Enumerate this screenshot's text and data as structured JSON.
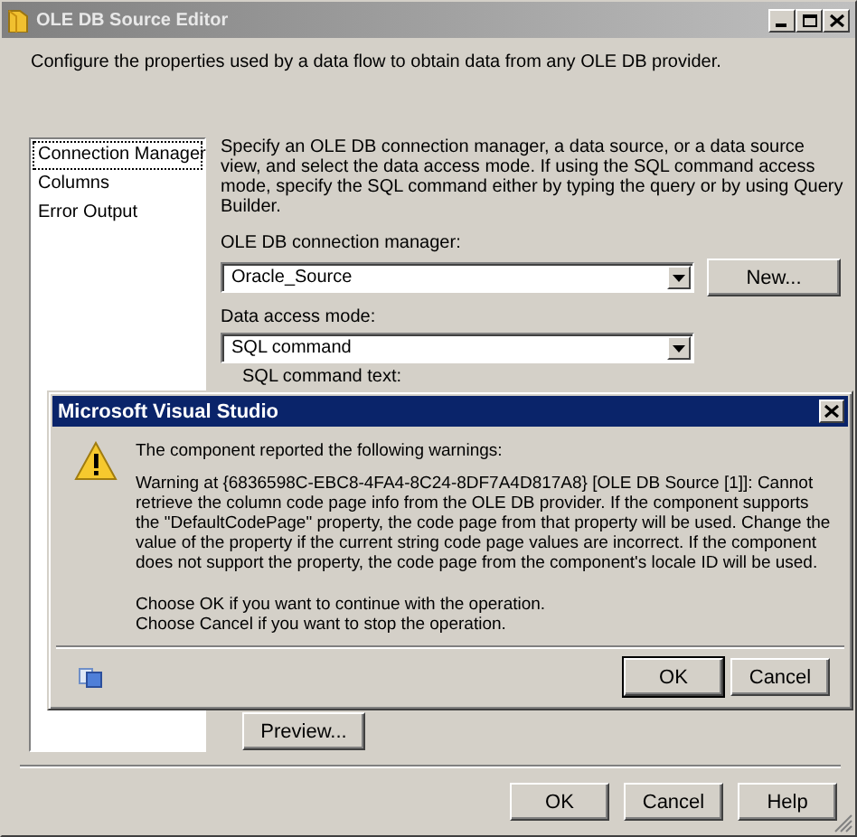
{
  "window": {
    "title": "OLE DB Source Editor"
  },
  "description": "Configure the properties used by a data flow to obtain data from any OLE DB provider.",
  "sidebar": {
    "items": [
      {
        "label": "Connection Manager",
        "selected": true
      },
      {
        "label": "Columns",
        "selected": false
      },
      {
        "label": "Error Output",
        "selected": false
      }
    ]
  },
  "connection_manager": {
    "instructions": "Specify an OLE DB connection manager, a data source, or a data source view, and select the data access mode. If using the SQL command access mode, specify the SQL command either by typing the query or by using Query Builder.",
    "connection_label": "OLE DB connection manager:",
    "connection_value": "Oracle_Source",
    "new_button": "New...",
    "access_mode_label": "Data access mode:",
    "access_mode_value": "SQL command",
    "sql_label": "SQL command text:",
    "preview_button": "Preview..."
  },
  "buttons": [
    "OK",
    "Cancel",
    "Help"
  ],
  "message_box": {
    "title": "Microsoft Visual Studio",
    "heading": "The component reported the following warnings:",
    "warning": "Warning at {6836598C-EBC8-4FA4-8C24-8DF7A4D817A8} [OLE DB Source [1]]: Cannot retrieve the column code page info from the OLE DB provider.  If the component supports the \"DefaultCodePage\" property, the code page from that property will be used.  Change the value of the property if the current string code page values are incorrect.  If the component does not support the property, the code page from the component's locale ID will be used.",
    "choose_ok": "Choose OK if you want to continue with the operation.",
    "choose_cancel": "Choose Cancel if you want to stop the operation.",
    "buttons": [
      {
        "label": "OK",
        "default": true
      },
      {
        "label": "Cancel",
        "default": false
      }
    ]
  }
}
